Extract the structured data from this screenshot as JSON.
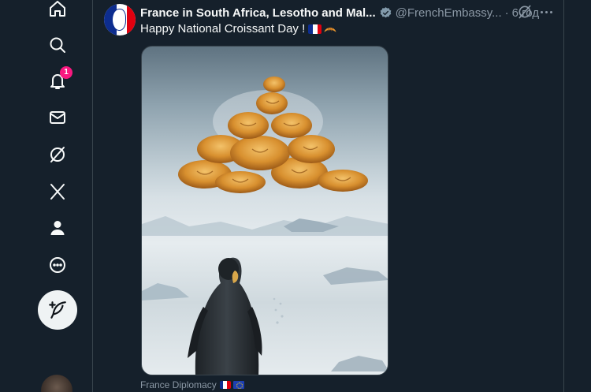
{
  "sidebar": {
    "items": [
      {
        "name": "home",
        "icon": "home-icon"
      },
      {
        "name": "explore",
        "icon": "search-icon"
      },
      {
        "name": "notifications",
        "icon": "bell-icon",
        "badge": "1"
      },
      {
        "name": "messages",
        "icon": "envelope-icon"
      },
      {
        "name": "grok",
        "icon": "grok-icon"
      },
      {
        "name": "premium",
        "icon": "x-logo-icon"
      },
      {
        "name": "profile",
        "icon": "person-icon"
      },
      {
        "name": "more",
        "icon": "more-circle-icon"
      }
    ],
    "compose_icon": "feather-plus-icon"
  },
  "post": {
    "display_name": "France in South Africa, Lesotho and Mal...",
    "handle": "@FrenchEmbassy...",
    "separator": "·",
    "time": "6 год",
    "text": "Happy National Croissant Day !",
    "caption": "France Diplomacy"
  },
  "colors": {
    "background": "#15202b",
    "border": "#38444d",
    "muted_text": "#8b98a5",
    "verified": "#829aab",
    "badge": "#f91880",
    "flag_blue": "#0d2d8f",
    "flag_red": "#e1000f"
  }
}
